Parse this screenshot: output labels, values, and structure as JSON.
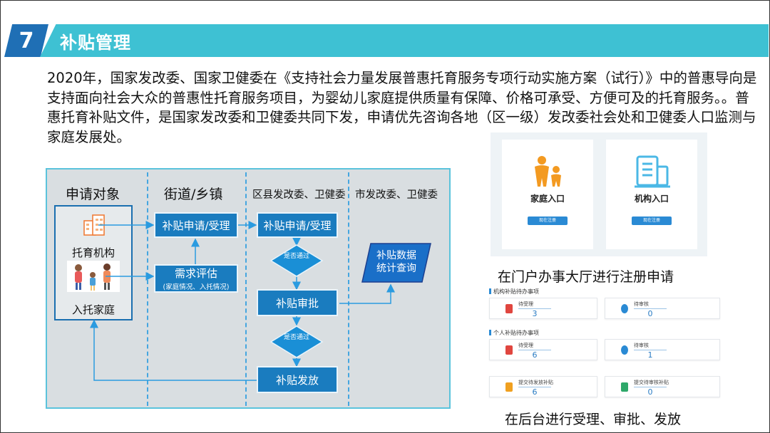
{
  "header": {
    "number": "7",
    "title": "补贴管理"
  },
  "intro": "2020年，国家发改委、国家卫健委在《支持社会力量发展普惠托育服务专项行动实施方案（试行）》中的普惠导向是支持面向社会大众的普惠性托育服务项目，为婴幼儿家庭提供质量有保障、价格可承受、方便可及的托育服务。。普惠托育补贴文件，是国家发改委和卫健委共同下发，申请优先咨询各地（区一级）发改委社会处和卫健委人口监测与家庭发展处。",
  "flow": {
    "lanes": [
      "申请对象",
      "街道/乡镇",
      "区县发改委、卫健委",
      "市发改委、卫健委"
    ],
    "applicants": {
      "institution": "托育机构",
      "family": "入托家庭"
    },
    "boxes": {
      "street_apply": "补贴申请/受理",
      "needs": "需求评估",
      "needs_sub": "(家庭情况、入托情况)",
      "county_apply": "补贴申请/受理",
      "approve": "补贴审批",
      "payout": "补贴发放",
      "stats": "补贴数据统计查询"
    },
    "decision": "是否通过"
  },
  "portal": {
    "family_entry": "家庭入口",
    "institution_entry": "机构入口",
    "family_btn": "现在注册",
    "institution_btn": "现在注册",
    "caption": "在门户办事大厅进行注册申请"
  },
  "backoffice": {
    "institution_section": "机构补贴待办事项",
    "individual_section": "个人补贴待办事项",
    "cards": [
      {
        "label": "待受理",
        "value": "3",
        "icon_color": "#e0463f"
      },
      {
        "label": "待审核",
        "value": "0",
        "icon_color": "#2a8ad4"
      },
      {
        "label": "待受理",
        "value": "6",
        "icon_color": "#e0463f"
      },
      {
        "label": "待审核",
        "value": "1",
        "icon_color": "#2a8ad4"
      },
      {
        "label": "提交待发放补贴",
        "value": "6",
        "icon_color": "#f0a020"
      },
      {
        "label": "提交待审核补贴",
        "value": "0",
        "icon_color": "#2ea86a"
      }
    ],
    "caption": "在后台进行受理、审批、发放"
  },
  "colors": {
    "accent": "#3ec1d3",
    "badge": "#1f6fb5",
    "box": "#1a7cbf",
    "icon_orange": "#f39a21",
    "icon_blue": "#4bb8e6"
  }
}
